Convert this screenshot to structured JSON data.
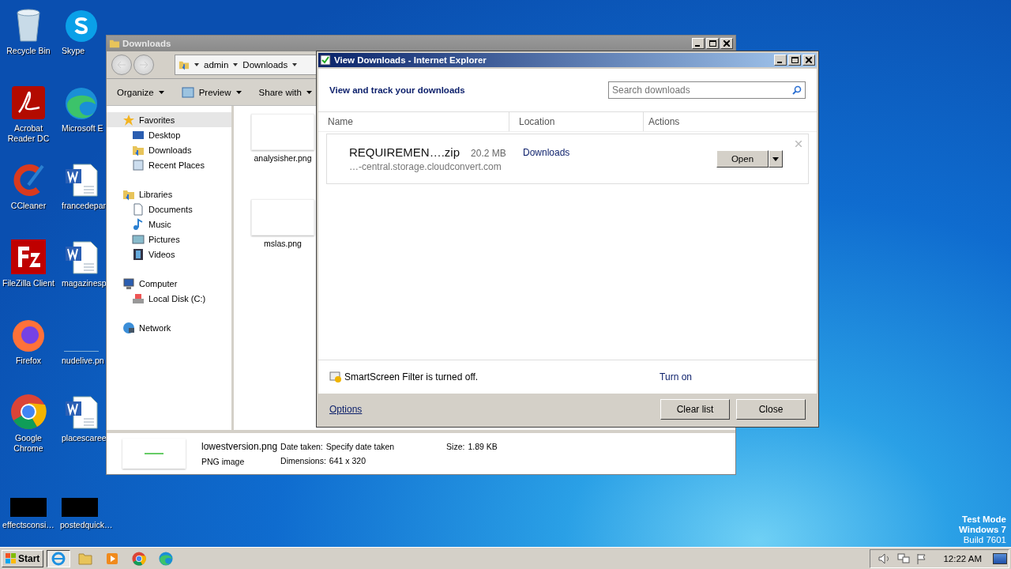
{
  "desktop_icons": [
    {
      "label": "Recycle Bin",
      "kind": "recycle"
    },
    {
      "label": "Skype",
      "kind": "skype"
    },
    {
      "label": "Acrobat Reader DC",
      "kind": "acrobat"
    },
    {
      "label": "Microsoft E",
      "kind": "edge"
    },
    {
      "label": "CCleaner",
      "kind": "ccleaner"
    },
    {
      "label": "francedepar",
      "kind": "word"
    },
    {
      "label": "FileZilla Client",
      "kind": "filezilla"
    },
    {
      "label": "magazinesp",
      "kind": "word"
    },
    {
      "label": "Firefox",
      "kind": "firefox"
    },
    {
      "label": "nudelive.pn",
      "kind": "blank"
    },
    {
      "label": "Google Chrome",
      "kind": "chrome"
    },
    {
      "label": "placescaree",
      "kind": "word"
    },
    {
      "label": "effectsconsi…",
      "kind": "dark"
    },
    {
      "label": "postedquick…",
      "kind": "dark"
    }
  ],
  "explorer": {
    "title": "Downloads",
    "breadcrumbs": [
      "admin",
      "Downloads"
    ],
    "toolbar": [
      "Organize",
      "Preview",
      "Share with"
    ],
    "nav": [
      {
        "label": "Favorites",
        "kind": "star",
        "selected": true,
        "children": [
          {
            "label": "Desktop",
            "kind": "desktop",
            "selected": false
          },
          {
            "label": "Downloads",
            "kind": "folder",
            "selected": false
          },
          {
            "label": "Recent Places",
            "kind": "recent",
            "selected": false
          }
        ]
      },
      {
        "label": "Libraries",
        "kind": "libraries",
        "selected": false,
        "children": [
          {
            "label": "Documents",
            "kind": "document",
            "selected": false
          },
          {
            "label": "Music",
            "kind": "music",
            "selected": false
          },
          {
            "label": "Pictures",
            "kind": "pictures",
            "selected": false
          },
          {
            "label": "Videos",
            "kind": "videos",
            "selected": false
          }
        ]
      },
      {
        "label": "Computer",
        "kind": "computer",
        "selected": false,
        "children": [
          {
            "label": "Local Disk (C:)",
            "kind": "disk",
            "selected": false
          }
        ]
      },
      {
        "label": "Network",
        "kind": "network",
        "selected": false
      }
    ],
    "files": [
      {
        "name": "analysisher.png"
      },
      {
        "name": "mslas.png"
      }
    ],
    "details": {
      "name": "lowestversion.png",
      "type": "PNG image",
      "fields": [
        {
          "label": "Date taken:",
          "value": "Specify date taken"
        },
        {
          "label": "Dimensions:",
          "value": "641 x 320"
        },
        {
          "label": "Size:",
          "value": "1.89 KB"
        }
      ]
    }
  },
  "downloads_dialog": {
    "title": "View Downloads - Internet Explorer",
    "heading": "View and track your downloads",
    "search": {
      "placeholder": "Search downloads"
    },
    "columns": [
      "Name",
      "Location",
      "Actions"
    ],
    "items": [
      {
        "name": "REQUIREMEN….zip",
        "size": "20.2 MB",
        "source": "…-central.storage.cloudconvert.com",
        "location": "Downloads",
        "action": "Open"
      }
    ],
    "smartscreen": {
      "message": "SmartScreen Filter is turned off.",
      "link": "Turn on"
    },
    "footer": {
      "link": "Options",
      "buttons": [
        "Clear list",
        "Close"
      ]
    }
  },
  "taskbar": {
    "start": "Start",
    "items": [
      {
        "kind": "ie",
        "selected": true
      },
      {
        "kind": "folder",
        "selected": false
      },
      {
        "kind": "media",
        "selected": false
      },
      {
        "kind": "chrome",
        "selected": false
      },
      {
        "kind": "edge",
        "selected": false
      }
    ],
    "clock": "12:22 AM"
  },
  "watermark_lines": [
    "Test Mode",
    "Windows 7",
    "Build 7601"
  ]
}
